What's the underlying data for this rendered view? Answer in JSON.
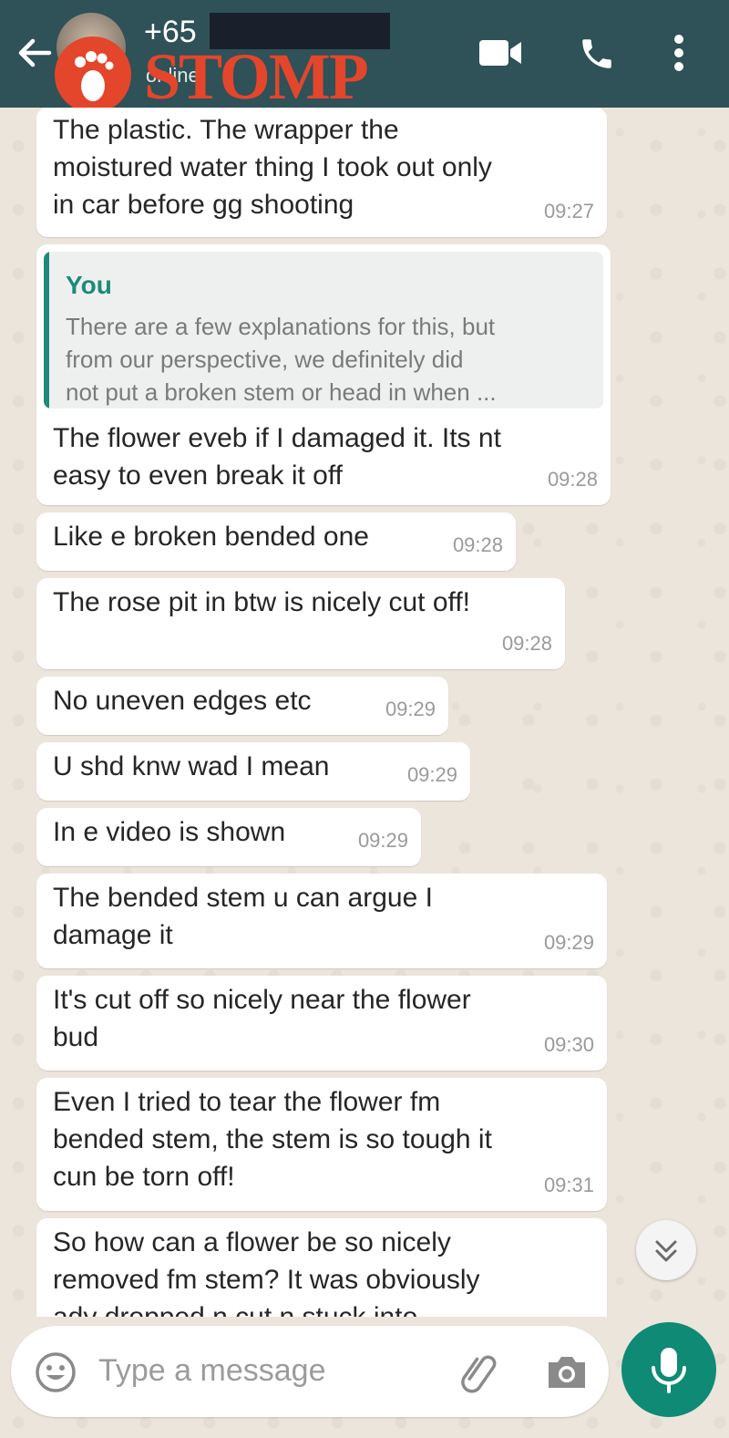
{
  "header": {
    "contact_name": "+65",
    "status": "online",
    "watermark_logo": "STOMP"
  },
  "messages": [
    {
      "text": "The plastic. The wrapper the\nmoistured water thing I took out only\nin car before gg shooting",
      "time": "09:27"
    },
    {
      "quote_author": "You",
      "quote_text": "There are a few explanations for this, but\nfrom our perspective, we definitely did\nnot put a broken stem or head in when ...",
      "text": "The flower eveb if I damaged it. Its nt\neasy to even break it off",
      "time": "09:28"
    },
    {
      "text": "Like e broken bended one",
      "time": "09:28"
    },
    {
      "text": "The rose pit in btw is nicely cut off!",
      "time": "09:28"
    },
    {
      "text": "No uneven edges etc",
      "time": "09:29"
    },
    {
      "text": "U shd knw wad I mean",
      "time": "09:29"
    },
    {
      "text": "In e video is shown",
      "time": "09:29"
    },
    {
      "text": "The bended stem u can argue I\ndamage it",
      "time": "09:29"
    },
    {
      "text": "It's cut off so nicely near the flower\nbud",
      "time": "09:30"
    },
    {
      "text": "Even I tried to tear the  flower fm\nbended stem, the stem is so tough it\ncun be torn off!",
      "time": "09:31"
    },
    {
      "text": "So how can a flower be so nicely\nremoved fm stem? It was obviously\nady dropped n cut n stuck into"
    }
  ],
  "composer": {
    "placeholder": "Type a message"
  },
  "icons": {
    "back": "arrow-left-icon",
    "video": "video-call-icon",
    "phone": "phone-icon",
    "menu": "more-vertical-icon",
    "scroll": "chevrons-down-icon",
    "emoji": "emoji-icon",
    "attach": "paperclip-icon",
    "camera": "camera-icon",
    "mic": "microphone-icon"
  },
  "colors": {
    "header": "#2f5158",
    "bubble": "#ffffff",
    "accent": "#0f8a74",
    "watermark": "#e3462b"
  }
}
